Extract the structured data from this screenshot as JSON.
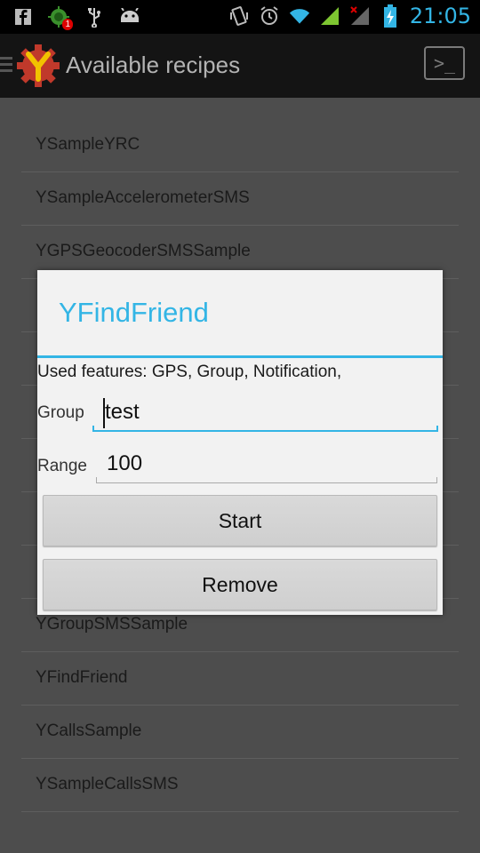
{
  "status_bar": {
    "time": "21:05",
    "left_icons": [
      "facebook-icon",
      "bug-notification-icon",
      "usb-icon",
      "android-debug-icon"
    ],
    "right_icons": [
      "vibrate-icon",
      "alarm-icon",
      "wifi-icon",
      "signal-icon",
      "no-signal-icon",
      "battery-charging-icon"
    ],
    "notification_badge": "1"
  },
  "action_bar": {
    "title": "Available recipes",
    "terminal_prompt": ">_"
  },
  "recipes": [
    "YSampleYRC",
    "YSampleAccelerometerSMS",
    "YGPSGeocoderSMSSample",
    "",
    "",
    "",
    "",
    "",
    "",
    "YGroupSMSSample",
    "YFindFriend",
    "YCallsSample",
    "YSampleCallsSMS"
  ],
  "dialog": {
    "title": "YFindFriend",
    "features": "Used features: GPS, Group, Notification,",
    "group_label": "Group",
    "group_value": "test",
    "range_label": "Range",
    "range_value": "100",
    "start_button": "Start",
    "remove_button": "Remove"
  },
  "colors": {
    "accent": "#33b5e5",
    "dim_background": "#4d4d4d",
    "dialog_background": "#f2f2f2"
  }
}
